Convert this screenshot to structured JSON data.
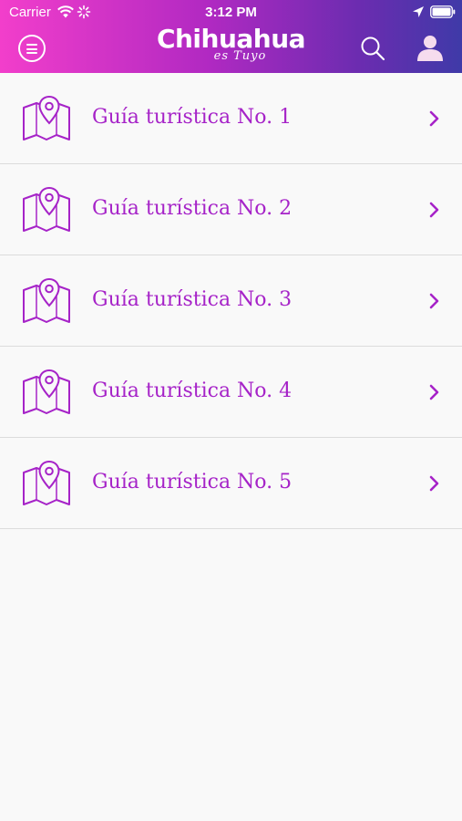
{
  "status_bar": {
    "carrier": "Carrier",
    "time": "3:12 PM"
  },
  "header": {
    "brand_name": "Chihuahua",
    "brand_tagline": "es Tuyo",
    "menu_icon": "menu-icon",
    "search_icon": "search-icon",
    "user_icon": "user-icon"
  },
  "colors": {
    "accent": "#a623c8",
    "header_gradient_start": "#f23ecb",
    "header_gradient_end": "#3f3aa8",
    "background": "#f9f9f9"
  },
  "guides": {
    "items": [
      {
        "label": "Guía turística No. 1",
        "icon": "map-pin-icon"
      },
      {
        "label": "Guía turística No. 2",
        "icon": "map-pin-icon"
      },
      {
        "label": "Guía turística No. 3",
        "icon": "map-pin-icon"
      },
      {
        "label": "Guía turística No. 4",
        "icon": "map-pin-icon"
      },
      {
        "label": "Guía turística No. 5",
        "icon": "map-pin-icon"
      }
    ]
  }
}
